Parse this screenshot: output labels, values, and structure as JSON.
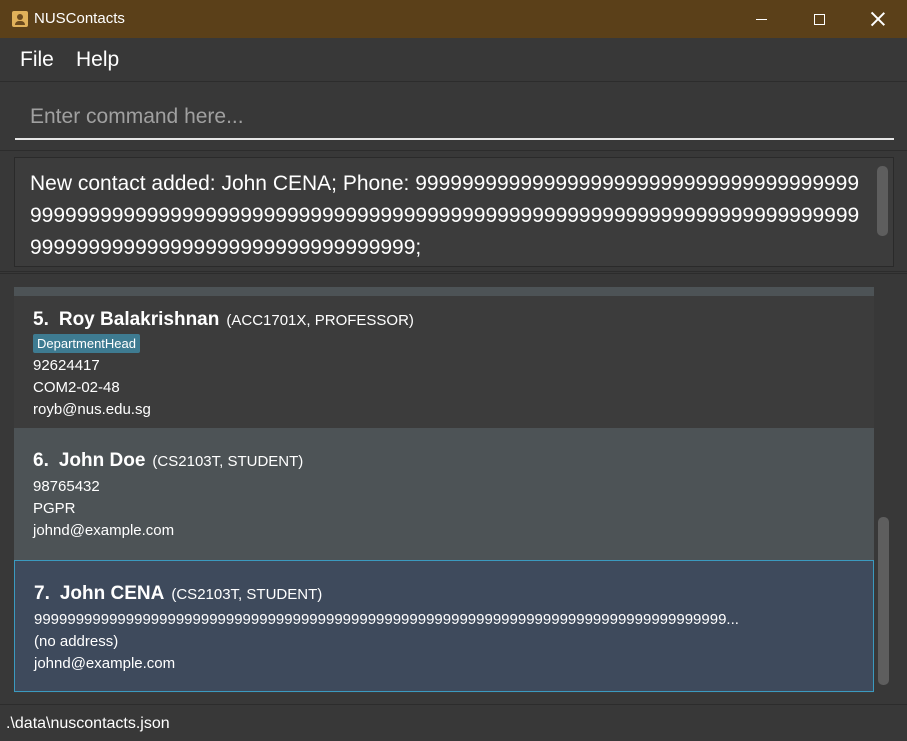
{
  "window": {
    "title": "NUSContacts"
  },
  "menu": {
    "file": "File",
    "help": "Help"
  },
  "command": {
    "placeholder": "Enter command here...",
    "value": ""
  },
  "result": {
    "text": "New contact added: John CENA; Phone: 9999999999999999999999999999999999999999999999999999999999999999999999999999999999999999999999999999999999999999999999999999999999999999999999;"
  },
  "contacts": [
    {
      "index": "5.",
      "name": "Roy Balakrishnan",
      "meta": "(ACC1701X, PROFESSOR)",
      "tag": "DepartmentHead",
      "phone": "92624417",
      "address": "COM2-02-48",
      "email": "royb@nus.edu.sg"
    },
    {
      "index": "6.",
      "name": "John Doe",
      "meta": "(CS2103T, STUDENT)",
      "phone": "98765432",
      "address": "PGPR",
      "email": "johnd@example.com"
    },
    {
      "index": "7.",
      "name": "John CENA",
      "meta": "(CS2103T, STUDENT)",
      "phone": "99999999999999999999999999999999999999999999999999999999999999999999999999999999999...",
      "address": "(no address)",
      "email": "johnd@example.com"
    }
  ],
  "status": {
    "path": ".\\data\\nuscontacts.json"
  },
  "colors": {
    "titlebar": "#5b4019",
    "background": "#383838",
    "selected_card": "#3e4a5c",
    "selected_border": "#3b9abf",
    "tag": "#3e7b91"
  }
}
